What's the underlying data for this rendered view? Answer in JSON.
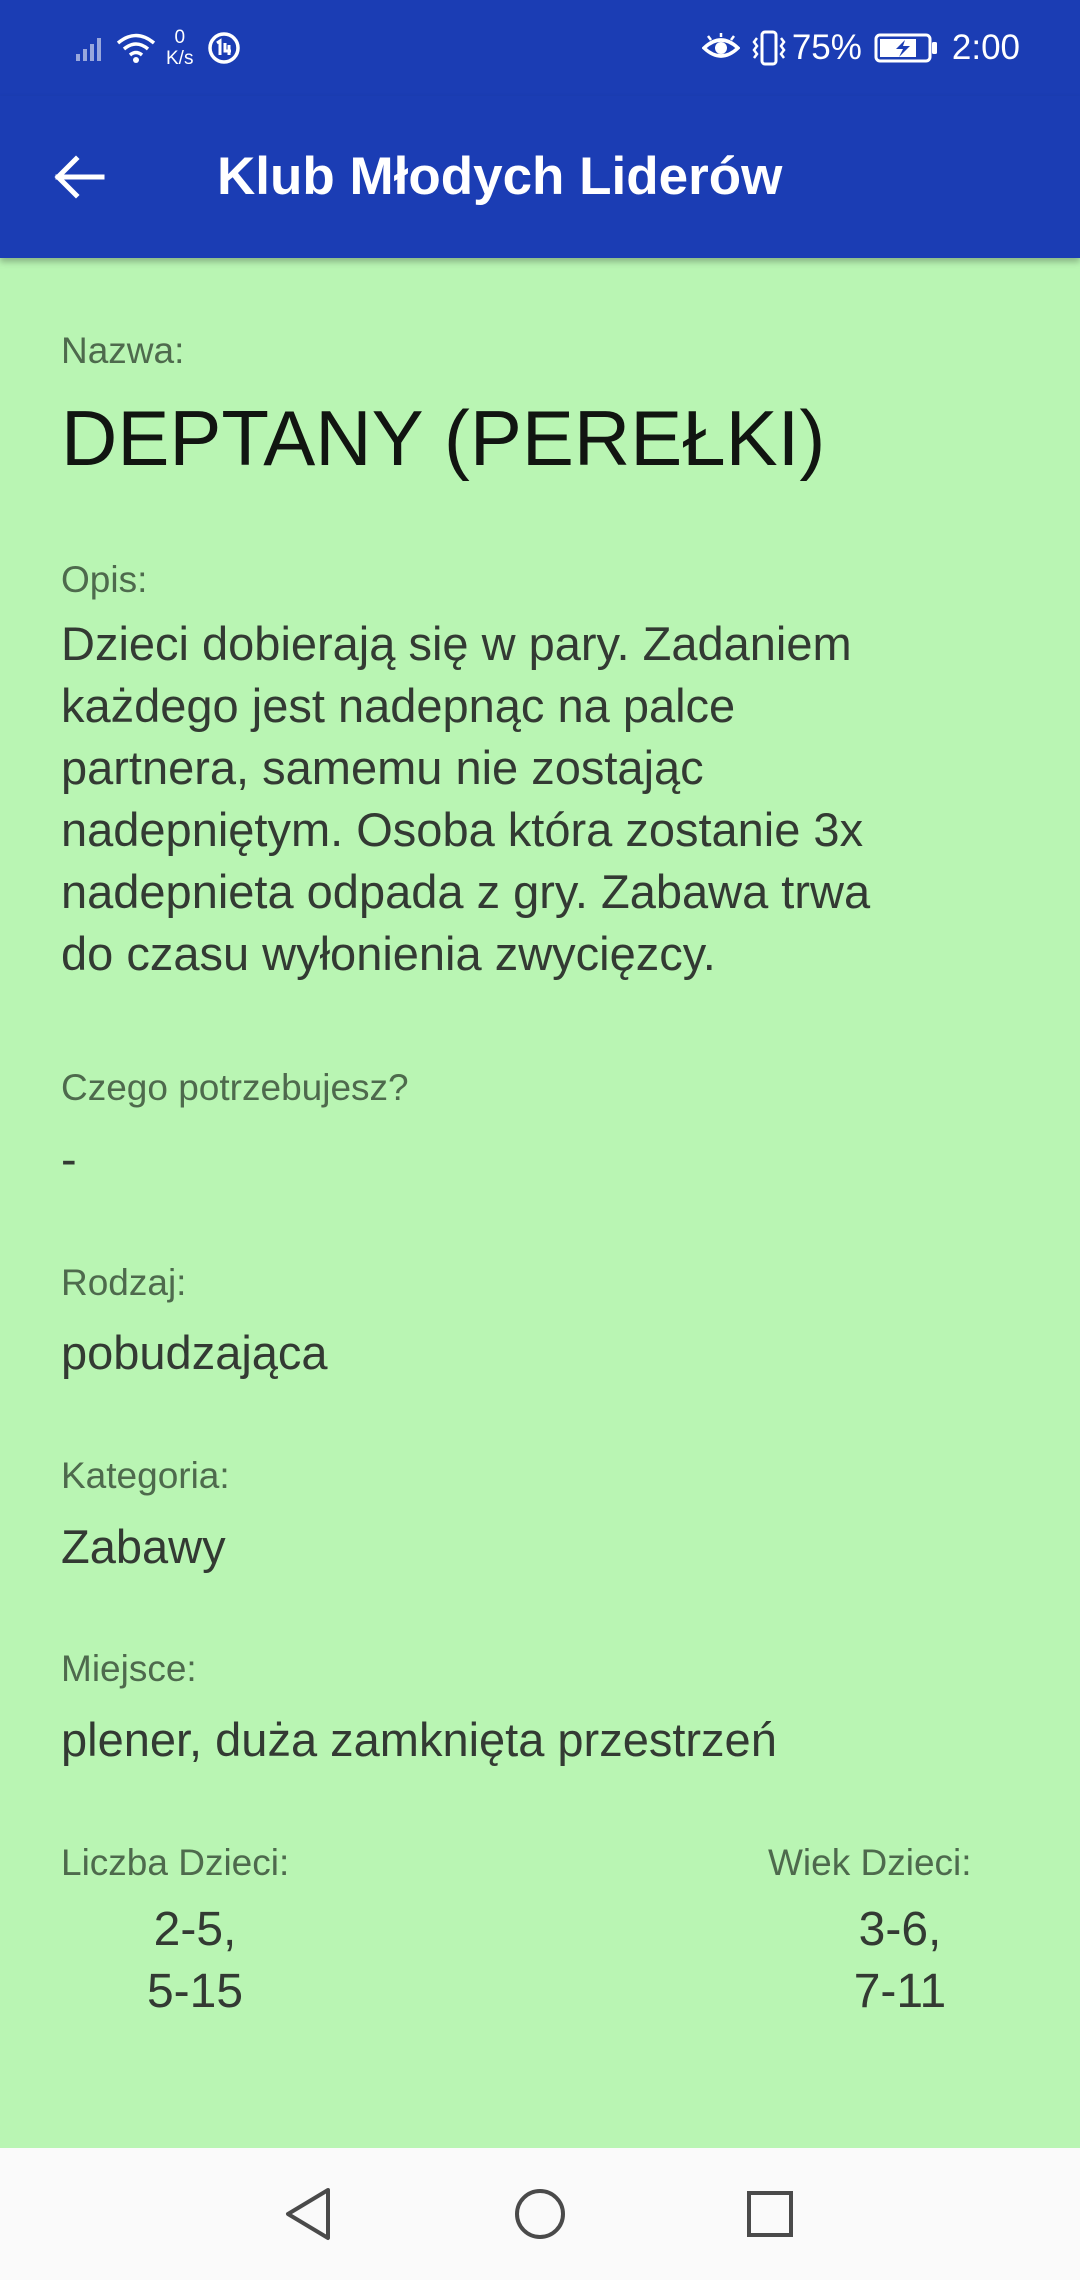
{
  "status_bar": {
    "net_speed_value": "0",
    "net_speed_unit": "K/s",
    "battery_percent": "75%",
    "time": "2:00",
    "icons": [
      "signal-icon",
      "wifi-icon",
      "data-saver-icon",
      "eye-comfort-icon",
      "vibrate-icon",
      "battery-charging-icon"
    ]
  },
  "app_bar": {
    "title": "Klub Młodych Liderów",
    "back_icon": "arrow-back-icon"
  },
  "details": {
    "name_label": "Nazwa:",
    "name_value": "DEPTANY (PEREŁKI)",
    "description_label": "Opis:",
    "description_lines": [
      "Dzieci dobierają się w pary. Zadaniem",
      "każdego jest nadepnąc na palce",
      "partnera, samemu nie zostając",
      "nadepniętym. Osoba która zostanie 3x",
      "nadepnieta odpada z gry. Zabawa trwa",
      "do czasu wyłonienia zwycięzcy."
    ],
    "needs_label": "Czego potrzebujesz?",
    "needs_value": "-",
    "type_label": "Rodzaj:",
    "type_value": "pobudzająca",
    "category_label": "Kategoria:",
    "category_value": "Zabawy",
    "place_label": "Miejsce:",
    "place_value": "plener, duża zamknięta przestrzeń",
    "children_count_label": "Liczba Dzieci:",
    "children_count_values": [
      "2-5,",
      "5-15"
    ],
    "children_age_label": "Wiek Dzieci:",
    "children_age_values": [
      "3-6,",
      "7-11"
    ]
  },
  "nav_bar": {
    "icons": [
      "back-triangle-icon",
      "home-circle-icon",
      "recents-square-icon"
    ]
  },
  "colors": {
    "app_bar": "#1b3db4",
    "background": "#b9f5b3",
    "label": "#4e6a4d",
    "value": "#333a33"
  }
}
